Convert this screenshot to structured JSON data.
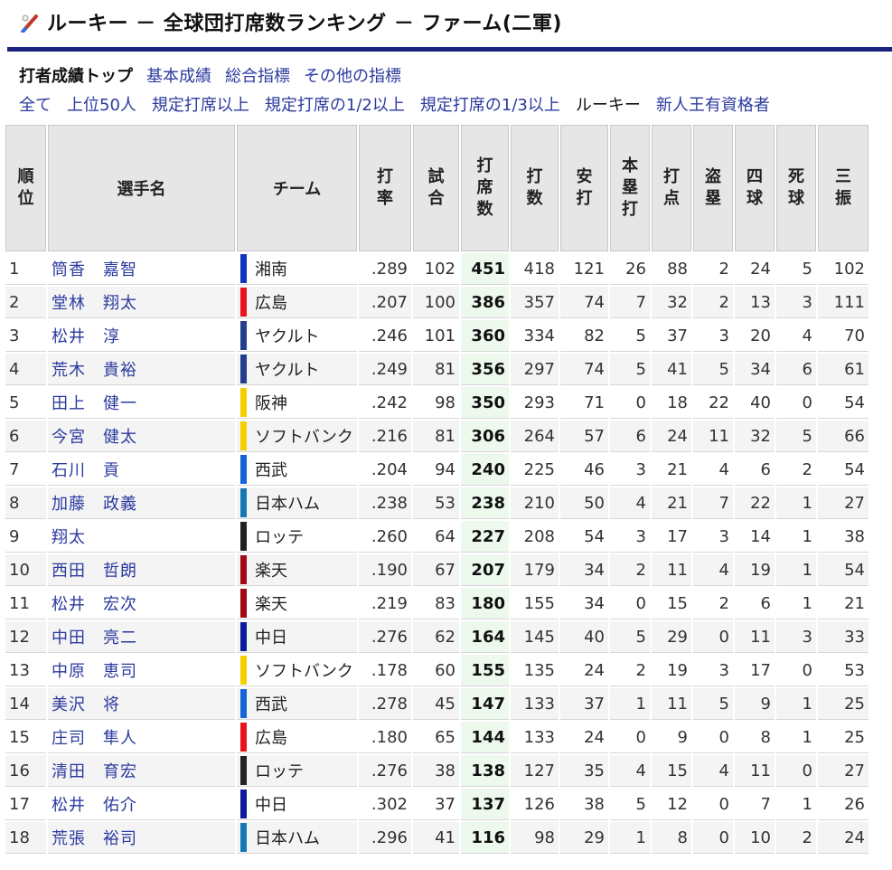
{
  "page": {
    "title": "ルーキー － 全球団打席数ランキング － ファーム(二軍)"
  },
  "nav": {
    "primary": [
      {
        "label": "打者成績トップ",
        "current": true
      },
      {
        "label": "基本成績",
        "current": false
      },
      {
        "label": "総合指標",
        "current": false
      },
      {
        "label": "その他の指標",
        "current": false
      }
    ],
    "filters": [
      {
        "label": "全て",
        "current": false
      },
      {
        "label": "上位50人",
        "current": false
      },
      {
        "label": "規定打席以上",
        "current": false
      },
      {
        "label": "規定打席の1/2以上",
        "current": false
      },
      {
        "label": "規定打席の1/3以上",
        "current": false
      },
      {
        "label": "ルーキー",
        "current": true
      },
      {
        "label": "新人王有資格者",
        "current": false
      }
    ]
  },
  "table": {
    "headers": [
      "順位",
      "選手名",
      "チーム",
      "打率",
      "試合",
      "打席数",
      "打数",
      "安打",
      "本塁打",
      "打点",
      "盗塁",
      "四球",
      "死球",
      "三振"
    ],
    "rows": [
      {
        "rank": "1",
        "player": "筒香　嘉智",
        "team": "湘南",
        "team_color": "#1035c0",
        "avg": ".289",
        "games": "102",
        "pa": "451",
        "ab": "418",
        "hits": "121",
        "hr": "26",
        "rbi": "88",
        "sb": "2",
        "bb": "24",
        "hbp": "5",
        "so": "102"
      },
      {
        "rank": "2",
        "player": "堂林　翔太",
        "team": "広島",
        "team_color": "#e8121a",
        "avg": ".207",
        "games": "100",
        "pa": "386",
        "ab": "357",
        "hits": "74",
        "hr": "7",
        "rbi": "32",
        "sb": "2",
        "bb": "13",
        "hbp": "3",
        "so": "111"
      },
      {
        "rank": "3",
        "player": "松井　淳",
        "team": "ヤクルト",
        "team_color": "#233e8c",
        "avg": ".246",
        "games": "101",
        "pa": "360",
        "ab": "334",
        "hits": "82",
        "hr": "5",
        "rbi": "37",
        "sb": "3",
        "bb": "20",
        "hbp": "4",
        "so": "70"
      },
      {
        "rank": "4",
        "player": "荒木　貴裕",
        "team": "ヤクルト",
        "team_color": "#233e8c",
        "avg": ".249",
        "games": "81",
        "pa": "356",
        "ab": "297",
        "hits": "74",
        "hr": "5",
        "rbi": "41",
        "sb": "5",
        "bb": "34",
        "hbp": "6",
        "so": "61"
      },
      {
        "rank": "5",
        "player": "田上　健一",
        "team": "阪神",
        "team_color": "#f5d000",
        "avg": ".242",
        "games": "98",
        "pa": "350",
        "ab": "293",
        "hits": "71",
        "hr": "0",
        "rbi": "18",
        "sb": "22",
        "bb": "40",
        "hbp": "0",
        "so": "54"
      },
      {
        "rank": "6",
        "player": "今宮　健太",
        "team": "ソフトバンク",
        "team_color": "#f5d000",
        "avg": ".216",
        "games": "81",
        "pa": "306",
        "ab": "264",
        "hits": "57",
        "hr": "6",
        "rbi": "24",
        "sb": "11",
        "bb": "32",
        "hbp": "5",
        "so": "66"
      },
      {
        "rank": "7",
        "player": "石川　貢",
        "team": "西武",
        "team_color": "#1463d8",
        "avg": ".204",
        "games": "94",
        "pa": "240",
        "ab": "225",
        "hits": "46",
        "hr": "3",
        "rbi": "21",
        "sb": "4",
        "bb": "6",
        "hbp": "2",
        "so": "54"
      },
      {
        "rank": "8",
        "player": "加藤　政義",
        "team": "日本ハム",
        "team_color": "#1478b4",
        "avg": ".238",
        "games": "53",
        "pa": "238",
        "ab": "210",
        "hits": "50",
        "hr": "4",
        "rbi": "21",
        "sb": "7",
        "bb": "22",
        "hbp": "1",
        "so": "27"
      },
      {
        "rank": "9",
        "player": "翔太",
        "team": "ロッテ",
        "team_color": "#222222",
        "avg": ".260",
        "games": "64",
        "pa": "227",
        "ab": "208",
        "hits": "54",
        "hr": "3",
        "rbi": "17",
        "sb": "3",
        "bb": "14",
        "hbp": "1",
        "so": "38"
      },
      {
        "rank": "10",
        "player": "西田　哲朗",
        "team": "楽天",
        "team_color": "#a00a14",
        "avg": ".190",
        "games": "67",
        "pa": "207",
        "ab": "179",
        "hits": "34",
        "hr": "2",
        "rbi": "11",
        "sb": "4",
        "bb": "19",
        "hbp": "1",
        "so": "54"
      },
      {
        "rank": "11",
        "player": "松井　宏次",
        "team": "楽天",
        "team_color": "#a00a14",
        "avg": ".219",
        "games": "83",
        "pa": "180",
        "ab": "155",
        "hits": "34",
        "hr": "0",
        "rbi": "15",
        "sb": "2",
        "bb": "6",
        "hbp": "1",
        "so": "21"
      },
      {
        "rank": "12",
        "player": "中田　亮二",
        "team": "中日",
        "team_color": "#0a1a9a",
        "avg": ".276",
        "games": "62",
        "pa": "164",
        "ab": "145",
        "hits": "40",
        "hr": "5",
        "rbi": "29",
        "sb": "0",
        "bb": "11",
        "hbp": "3",
        "so": "33"
      },
      {
        "rank": "13",
        "player": "中原　恵司",
        "team": "ソフトバンク",
        "team_color": "#f5d000",
        "avg": ".178",
        "games": "60",
        "pa": "155",
        "ab": "135",
        "hits": "24",
        "hr": "2",
        "rbi": "19",
        "sb": "3",
        "bb": "17",
        "hbp": "0",
        "so": "53"
      },
      {
        "rank": "14",
        "player": "美沢　将",
        "team": "西武",
        "team_color": "#1463d8",
        "avg": ".278",
        "games": "45",
        "pa": "147",
        "ab": "133",
        "hits": "37",
        "hr": "1",
        "rbi": "11",
        "sb": "5",
        "bb": "9",
        "hbp": "1",
        "so": "25"
      },
      {
        "rank": "15",
        "player": "庄司　隼人",
        "team": "広島",
        "team_color": "#e8121a",
        "avg": ".180",
        "games": "65",
        "pa": "144",
        "ab": "133",
        "hits": "24",
        "hr": "0",
        "rbi": "9",
        "sb": "0",
        "bb": "8",
        "hbp": "1",
        "so": "25"
      },
      {
        "rank": "16",
        "player": "清田　育宏",
        "team": "ロッテ",
        "team_color": "#222222",
        "avg": ".276",
        "games": "38",
        "pa": "138",
        "ab": "127",
        "hits": "35",
        "hr": "4",
        "rbi": "15",
        "sb": "4",
        "bb": "11",
        "hbp": "0",
        "so": "27"
      },
      {
        "rank": "17",
        "player": "松井　佑介",
        "team": "中日",
        "team_color": "#0a1a9a",
        "avg": ".302",
        "games": "37",
        "pa": "137",
        "ab": "126",
        "hits": "38",
        "hr": "5",
        "rbi": "12",
        "sb": "0",
        "bb": "7",
        "hbp": "1",
        "so": "26"
      },
      {
        "rank": "18",
        "player": "荒張　裕司",
        "team": "日本ハム",
        "team_color": "#1478b4",
        "avg": ".296",
        "games": "41",
        "pa": "116",
        "ab": "98",
        "hits": "29",
        "hr": "1",
        "rbi": "8",
        "sb": "0",
        "bb": "10",
        "hbp": "2",
        "so": "24"
      }
    ]
  },
  "colors": {
    "title_rule": "#1a237e",
    "link": "#2b3a9e",
    "header_bg": "#e6e6e6",
    "highlight_column": "#eef9ee"
  }
}
